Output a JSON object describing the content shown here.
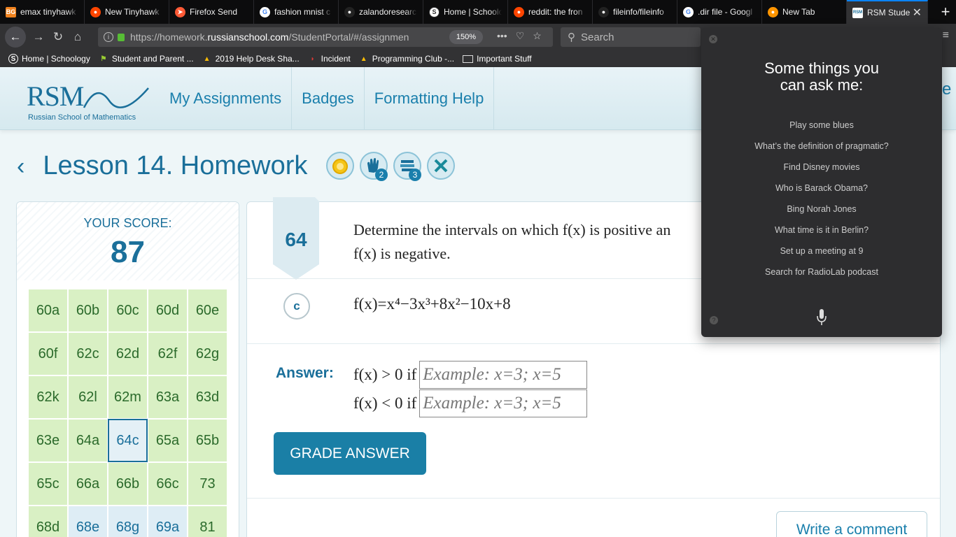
{
  "browser": {
    "tabs": [
      {
        "label": "emax tinyhawk",
        "icon": "bangood-icon",
        "color": "#f0821e"
      },
      {
        "label": "New Tinyhawk",
        "icon": "reddit-icon",
        "color": "#ff4500"
      },
      {
        "label": "Firefox Send",
        "icon": "firefox-send-icon",
        "color": "#ff5a36"
      },
      {
        "label": "fashion mnist c",
        "icon": "google-icon",
        "color": "#ffffff"
      },
      {
        "label": "zalandoresearc",
        "icon": "github-icon",
        "color": "#222222"
      },
      {
        "label": "Home | Schoolo",
        "icon": "schoology-icon",
        "color": "#ffffff"
      },
      {
        "label": "reddit: the fron",
        "icon": "reddit-icon",
        "color": "#ff4500"
      },
      {
        "label": "fileinfo/fileinfo",
        "icon": "github-icon",
        "color": "#222222"
      },
      {
        "label": ".dir file - Googl",
        "icon": "google-icon",
        "color": "#ffffff"
      },
      {
        "label": "New Tab",
        "icon": "firefox-icon",
        "color": "#ff9500"
      },
      {
        "label": "RSM Studen",
        "icon": "rsm-icon",
        "color": "#1a6f9a"
      }
    ],
    "url_prefix": "https://homework.",
    "url_domain": "russianschool.com",
    "url_rest": "/StudentPortal/#/assignmen",
    "zoom": "150%",
    "search_placeholder": "Search",
    "bookmarks": [
      {
        "label": "Home | Schoology",
        "icon": "schoology-icon"
      },
      {
        "label": "Student and Parent ...",
        "icon": "flag-icon"
      },
      {
        "label": "2019 Help Desk Sha...",
        "icon": "google-drive-icon"
      },
      {
        "label": "Incident",
        "icon": "servicenow-icon"
      },
      {
        "label": "Programming Club -...",
        "icon": "google-drive-icon"
      },
      {
        "label": "Important Stuff",
        "icon": "folder-icon"
      }
    ]
  },
  "site": {
    "logo_text": "RSM",
    "logo_subtitle": "Russian School of Mathematics",
    "nav": [
      "My Assignments",
      "Badges",
      "Formatting Help"
    ],
    "lesson_title": "Lesson 14. Homework",
    "badge_counts": [
      "2",
      "3"
    ]
  },
  "score": {
    "label": "YOUR SCORE:",
    "value": "87",
    "problems": [
      {
        "id": "60a",
        "state": "done"
      },
      {
        "id": "60b",
        "state": "done"
      },
      {
        "id": "60c",
        "state": "done"
      },
      {
        "id": "60d",
        "state": "done"
      },
      {
        "id": "60e",
        "state": "done"
      },
      {
        "id": "60f",
        "state": "done"
      },
      {
        "id": "62c",
        "state": "done"
      },
      {
        "id": "62d",
        "state": "done"
      },
      {
        "id": "62f",
        "state": "done"
      },
      {
        "id": "62g",
        "state": "done"
      },
      {
        "id": "62k",
        "state": "done"
      },
      {
        "id": "62l",
        "state": "done"
      },
      {
        "id": "62m",
        "state": "done"
      },
      {
        "id": "63a",
        "state": "done"
      },
      {
        "id": "63d",
        "state": "done"
      },
      {
        "id": "63e",
        "state": "done"
      },
      {
        "id": "64a",
        "state": "done"
      },
      {
        "id": "64c",
        "state": "selected"
      },
      {
        "id": "65a",
        "state": "done"
      },
      {
        "id": "65b",
        "state": "done"
      },
      {
        "id": "65c",
        "state": "done"
      },
      {
        "id": "66a",
        "state": "done"
      },
      {
        "id": "66b",
        "state": "done"
      },
      {
        "id": "66c",
        "state": "done"
      },
      {
        "id": "73",
        "state": "done"
      },
      {
        "id": "68d",
        "state": "done"
      },
      {
        "id": "68e",
        "state": "todo"
      },
      {
        "id": "68g",
        "state": "todo"
      },
      {
        "id": "69a",
        "state": "todo"
      },
      {
        "id": "81",
        "state": "done"
      }
    ]
  },
  "question": {
    "number": "64",
    "text_line1": "Determine the intervals on which f(x) is positive an",
    "text_line2": "f(x) is negative.",
    "part": "c",
    "formula": "f(x)=x⁴−3x³+8x²−10x+8",
    "answer_label": "Answer:",
    "answer_pos_prefix": "f(x) > 0 if",
    "answer_neg_prefix": "f(x) < 0 if",
    "answer_placeholder": "Example: x=3; x=5",
    "grade_button": "GRADE ANSWER",
    "comment_button": "Write a comment"
  },
  "assistant": {
    "heading_line1": "Some things you",
    "heading_line2": "can ask me:",
    "suggestions": [
      "Play some blues",
      "What’s the definition of pragmatic?",
      "Find Disney movies",
      "Who is Barack Obama?",
      "Bing Norah Jones",
      "What time is it in Berlin?",
      "Set up a meeting at 9",
      "Search for RadioLab podcast"
    ],
    "edge_letter": "e"
  }
}
